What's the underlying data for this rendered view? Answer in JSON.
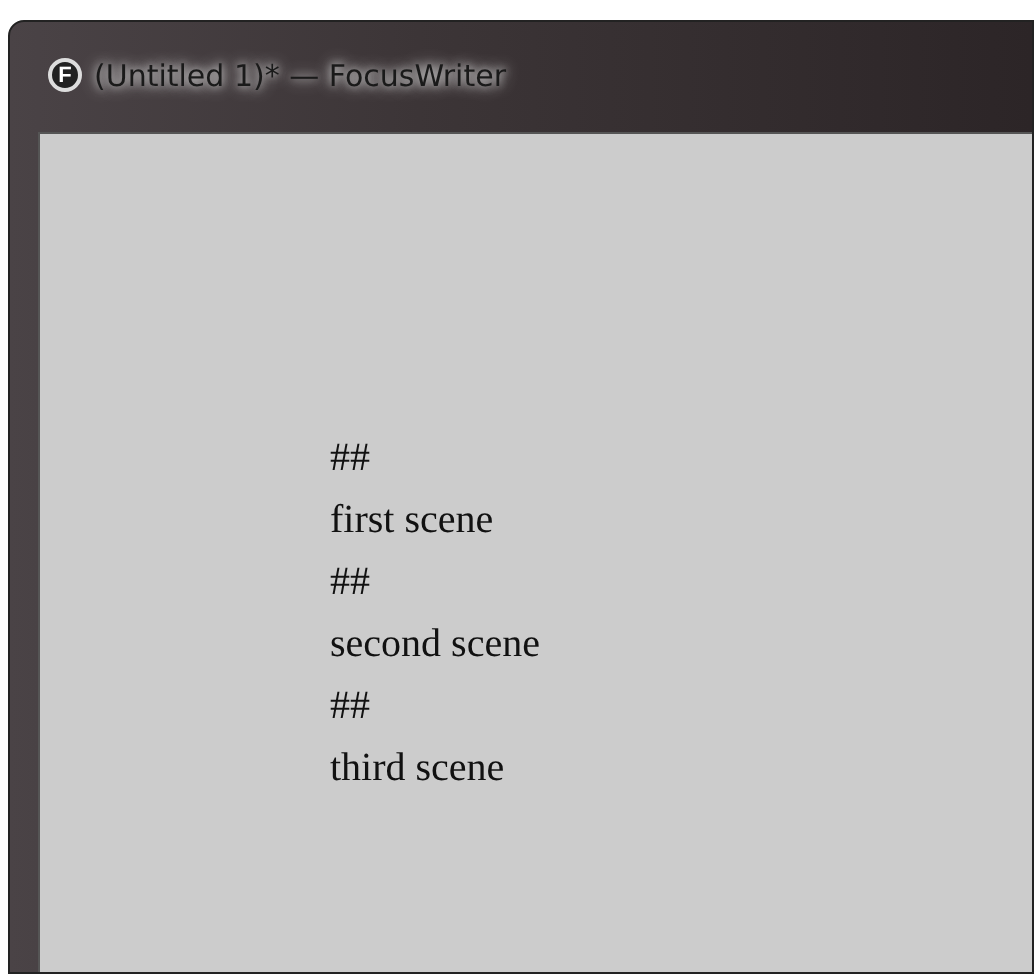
{
  "window": {
    "title": "(Untitled 1)* — FocusWriter",
    "icon_letter": "F"
  },
  "document": {
    "lines": [
      "##",
      "first scene",
      "##",
      "second scene",
      "##",
      "third scene"
    ]
  }
}
